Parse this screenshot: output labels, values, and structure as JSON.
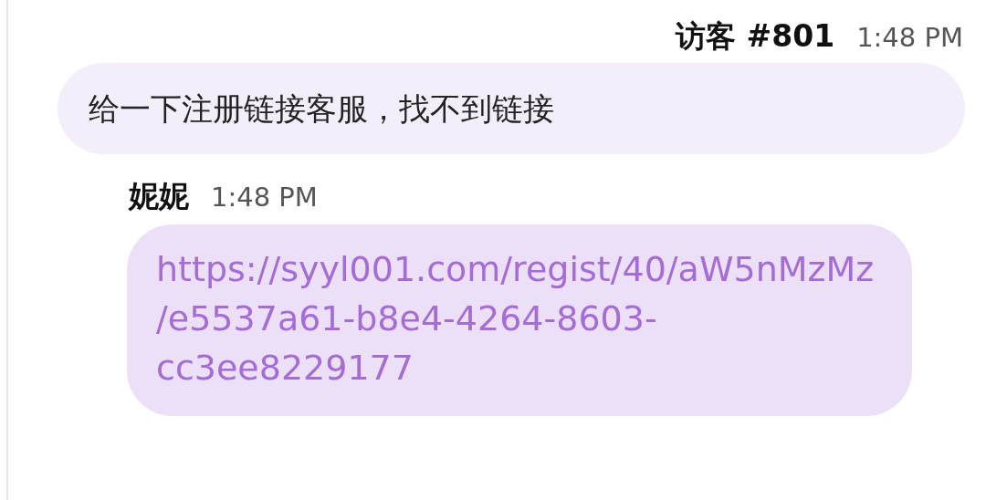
{
  "messages": [
    {
      "kind": "visitor",
      "sender": "访客 #801",
      "time": "1:48 PM",
      "text": "给一下注册链接客服，找不到链接"
    },
    {
      "kind": "agent",
      "sender": "妮妮",
      "time": "1:48 PM",
      "link": "https://syyl001.com/regist/40/aW5nMzMz/e5537a61-b8e4-4264-8603-cc3ee8229177"
    }
  ]
}
